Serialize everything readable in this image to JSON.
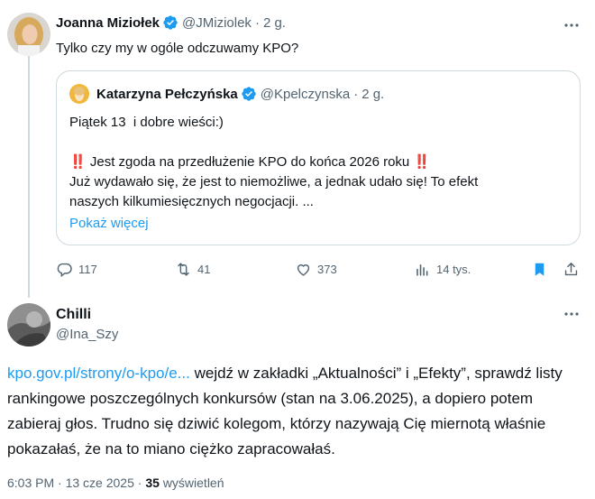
{
  "main_tweet": {
    "author_name": "Joanna Miziołek",
    "author_handle": "@JMiziolek",
    "separator": "·",
    "time": "2 g.",
    "text": "Tylko czy my w ogóle odczuwamy KPO?",
    "more": "•••"
  },
  "quote": {
    "author_name": "Katarzyna Pełczyńska",
    "author_handle": "@Kpelczynska",
    "separator": "·",
    "time": "2 g.",
    "line1": "Piątek 13  i dobre wieści:)",
    "line2_emoji_left": "‼️",
    "line2_text": "Jest zgoda na przedłużenie KPO do końca 2026 roku",
    "line2_emoji_right": "‼️",
    "line3": "Już wydawało się, że jest to niemożliwe, a jednak udało się! To efekt",
    "line4": "naszych kilkumiesięcznych negocjacji. ...",
    "show_more": "Pokaż więcej"
  },
  "actions": {
    "replies": "117",
    "reposts": "41",
    "likes": "373",
    "views": "14 tys."
  },
  "reply": {
    "author_name": "Chilli",
    "author_handle": "@Ina_Szy",
    "more": "•••",
    "link": "kpo.gov.pl/strony/o-kpo/e...",
    "text_after_link": " wejdź w zakładki „Aktualności” i „Efekty”, sprawdź listy rankingowe poszczególnych konkursów (stan na 3.06.2025), a dopiero potem zabieraj głos. Trudno się dziwić kolegom, którzy nazywają Cię miernotą właśnie pokazałaś, że na to miano ciężko zapracowałaś.",
    "time": "6:03 PM",
    "separator": "·",
    "date": "13 cze 2025",
    "separator2": "·",
    "views_count": "35",
    "views_label": "wyświetleń"
  },
  "colors": {
    "link": "#1d9bf0",
    "verified": "#1d9bf0",
    "bookmark": "#1d9bf0",
    "muted": "#536471"
  }
}
